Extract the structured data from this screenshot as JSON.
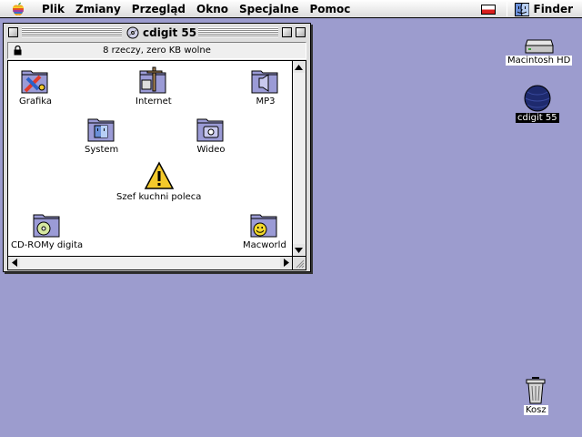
{
  "menubar": {
    "items": [
      "Plik",
      "Zmiany",
      "Przegląd",
      "Okno",
      "Specjalne",
      "Pomoc"
    ],
    "app_name": "Finder"
  },
  "window": {
    "title": "cdigit 55",
    "info": "8 rzeczy, zero KB wolne",
    "icons": [
      {
        "label": "Grafika",
        "icon": "graphics-folder-icon"
      },
      {
        "label": "Internet",
        "icon": "internet-folder-icon"
      },
      {
        "label": "MP3",
        "icon": "mp3-folder-icon"
      },
      {
        "label": "System",
        "icon": "system-folder-icon"
      },
      {
        "label": "Wideo",
        "icon": "video-folder-icon"
      },
      {
        "label": "Szef kuchni poleca",
        "icon": "warning-icon"
      },
      {
        "label": "CD-ROMy digita",
        "icon": "cd-folder-icon"
      },
      {
        "label": "Macworld",
        "icon": "smiley-folder-icon"
      }
    ]
  },
  "desktop": {
    "icons": [
      {
        "label": "Macintosh HD",
        "icon": "hard-disk-icon"
      },
      {
        "label": "cdigit 55",
        "icon": "cd-disc-icon",
        "selected": true
      },
      {
        "label": "Kosz",
        "icon": "trash-icon"
      }
    ]
  },
  "colors": {
    "desktop": "#9c9cce",
    "folder": "#9b9bd6",
    "flag_red": "#d81e1e"
  }
}
